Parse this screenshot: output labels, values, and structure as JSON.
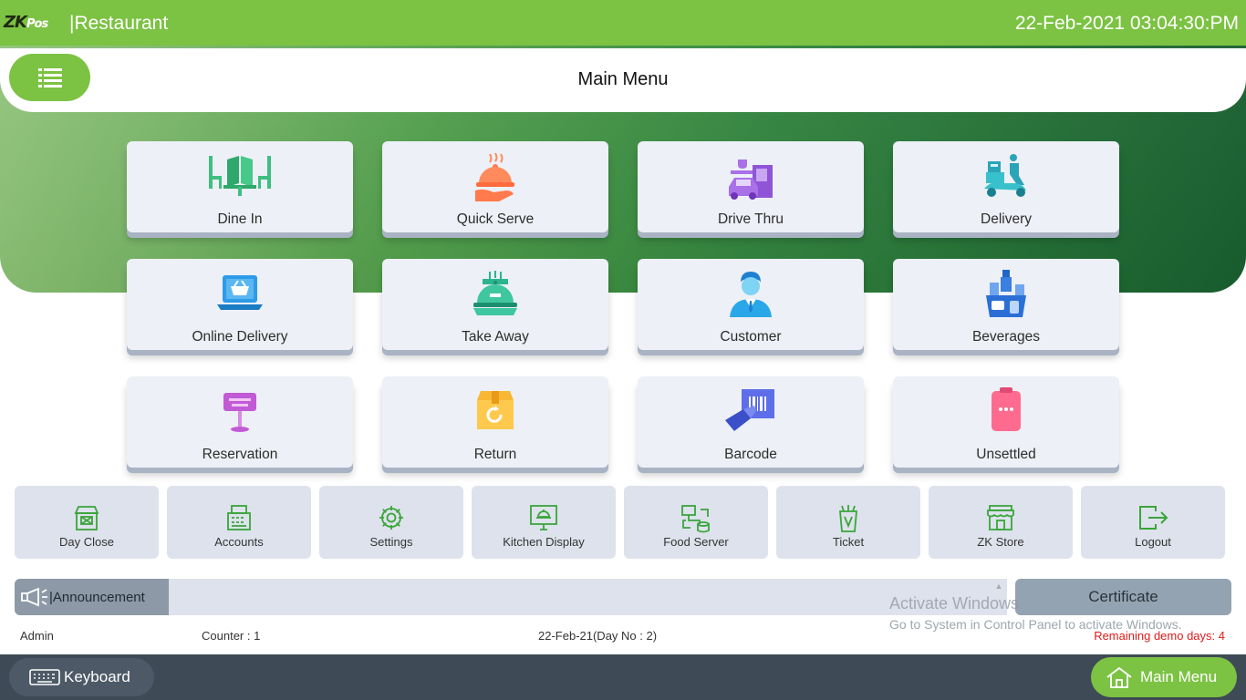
{
  "header": {
    "logo_main": "ZK",
    "logo_sub": "Pos",
    "app_title": "|Restaurant",
    "datetime": "22-Feb-2021 03:04:30:PM"
  },
  "title_bar": {
    "title": "Main Menu",
    "menu_icon": "list-icon"
  },
  "main_tiles": [
    {
      "label": "Dine In",
      "icon": "dine-in-icon"
    },
    {
      "label": "Quick Serve",
      "icon": "cloche-hand-icon"
    },
    {
      "label": "Drive Thru",
      "icon": "drive-thru-icon"
    },
    {
      "label": "Delivery",
      "icon": "delivery-scooter-icon"
    },
    {
      "label": "Online Delivery",
      "icon": "laptop-basket-icon"
    },
    {
      "label": "Take Away",
      "icon": "takeaway-cloche-icon"
    },
    {
      "label": "Customer",
      "icon": "customer-icon"
    },
    {
      "label": "Beverages",
      "icon": "beverages-icon"
    },
    {
      "label": "Reservation",
      "icon": "reserved-sign-icon"
    },
    {
      "label": "Return",
      "icon": "return-box-icon"
    },
    {
      "label": "Barcode",
      "icon": "barcode-scan-icon"
    },
    {
      "label": "Unsettled",
      "icon": "unsettled-bill-icon"
    }
  ],
  "quick_actions": [
    {
      "label": "Day Close",
      "icon": "store-closed-icon"
    },
    {
      "label": "Accounts",
      "icon": "cash-register-icon"
    },
    {
      "label": "Settings",
      "icon": "gear-icon"
    },
    {
      "label": "Kitchen Display",
      "icon": "kitchen-display-icon"
    },
    {
      "label": "Food Server",
      "icon": "food-server-icon"
    },
    {
      "label": "Ticket",
      "icon": "ticket-icon"
    },
    {
      "label": "ZK Store",
      "icon": "store-icon"
    },
    {
      "label": "Logout",
      "icon": "logout-icon"
    }
  ],
  "announcement": {
    "label": "|Announcement",
    "icon": "megaphone-icon"
  },
  "certificate": {
    "label": "Certificate"
  },
  "watermark": {
    "line1": "Activate Windows",
    "line2": "Go to System in Control Panel to activate Windows."
  },
  "status": {
    "user": "Admin",
    "counter": "Counter : 1",
    "date_day": "22-Feb-21(Day No : 2)",
    "demo_days": "Remaining demo days: 4"
  },
  "footer": {
    "keyboard_label": "Keyboard",
    "keyboard_icon": "keyboard-icon",
    "home_label": "Main Menu",
    "home_icon": "home-icon"
  },
  "colors": {
    "brand_green": "#7cc243",
    "footer_dark": "#3e4a56",
    "demo_warning": "#e01a1a"
  }
}
